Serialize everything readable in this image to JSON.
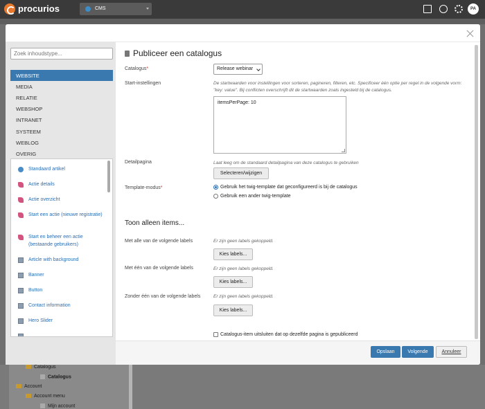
{
  "app": {
    "brand": "procurios",
    "workspace": "CMS",
    "avatar_initials": "PA"
  },
  "background_tree": {
    "items": [
      "Catalogus",
      "Catalogus",
      "Account",
      "Account menu",
      "Mijn account"
    ]
  },
  "sidebar": {
    "search_placeholder": "Zoek inhoudstype...",
    "categories": [
      "WEBSITE",
      "MEDIA",
      "RELATIE",
      "WEBSHOP",
      "INTRANET",
      "SYSTEEM",
      "WEBLOG",
      "OVERIG"
    ],
    "active_category": "WEBSITE",
    "content_types": [
      {
        "label": "Standaard artikel",
        "icon": "globe-icon"
      },
      {
        "label": "Actie details",
        "icon": "action-icon"
      },
      {
        "label": "Actie overzicht",
        "icon": "action-icon"
      },
      {
        "label": "Start een actie (nieuwe registratie)",
        "icon": "action-icon"
      },
      {
        "label": "Start en beheer een actie (bestaande gebruikers)",
        "icon": "action-icon"
      },
      {
        "label": "Article with background",
        "icon": "component-icon"
      },
      {
        "label": "Banner",
        "icon": "component-icon"
      },
      {
        "label": "Button",
        "icon": "component-icon"
      },
      {
        "label": "Contact information",
        "icon": "component-icon"
      },
      {
        "label": "Hero Slider",
        "icon": "component-icon"
      }
    ]
  },
  "form": {
    "title": "Publiceer een catalogus",
    "catalogus": {
      "label": "Catalogus",
      "required_mark": "*",
      "value": "Release webinar"
    },
    "start": {
      "label": "Start-instellingen",
      "help": "De startwaarden voor instellingen voor sorteren, pagineren, filteren, etc. Specificeer één optie per regel in de volgende vorm: \"key: value\". Bij conflicten overschrijft dit de startwaarden zoals ingesteld bij de catalogus.",
      "value": "itemsPerPage: 10"
    },
    "detail": {
      "label": "Detailpagina",
      "help": "Laat leeg om de standaard detailpagina van deze catalogus te gebruiken",
      "button": "Selecteren/wijzigen"
    },
    "template": {
      "label": "Template-modus",
      "required_mark": "*",
      "options": [
        "Gebruik het twig-template dat geconfigureerd is bij de catalogus",
        "Gebruik een ander twig-template"
      ],
      "selected_index": 0
    },
    "section_title": "Toon alleen items...",
    "labels_all": {
      "label": "Met alle van de volgende labels",
      "help": "Er zijn geen labels gekoppeld.",
      "button": "Kies labels..."
    },
    "labels_one": {
      "label": "Met één van de volgende labels",
      "help": "Er zijn geen labels gekoppeld.",
      "button": "Kies labels..."
    },
    "labels_none": {
      "label": "Zonder één van de volgende labels",
      "help": "Er zijn geen labels gekoppeld.",
      "button": "Kies labels..."
    },
    "exclude": {
      "label": "Catalogus-item uitsluiten dat op dezelfde pagina is gepubliceerd",
      "checked": false
    }
  },
  "footer": {
    "save": "Opslaan",
    "next": "Volgende",
    "cancel": "Annuleer"
  },
  "colors": {
    "primary": "#3a79b0",
    "brand": "#e8782c",
    "topbar": "#3a3a3a"
  }
}
